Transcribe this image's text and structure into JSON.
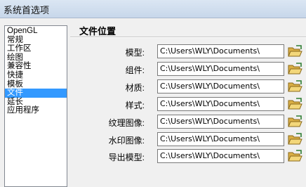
{
  "window": {
    "title": "系统首选项"
  },
  "nav": {
    "items": [
      {
        "label": "OpenGL",
        "selected": false
      },
      {
        "label": "常规",
        "selected": false
      },
      {
        "label": "工作区",
        "selected": false
      },
      {
        "label": "绘图",
        "selected": false
      },
      {
        "label": "兼容性",
        "selected": false
      },
      {
        "label": "快捷",
        "selected": false
      },
      {
        "label": "模板",
        "selected": false
      },
      {
        "label": "文件",
        "selected": true
      },
      {
        "label": "延长",
        "selected": false
      },
      {
        "label": "应用程序",
        "selected": false
      }
    ]
  },
  "section": {
    "title": "文件位置",
    "rows": [
      {
        "label": "模型:",
        "path": "C:\\Users\\WLY\\Documents\\"
      },
      {
        "label": "组件:",
        "path": "C:\\Users\\WLY\\Documents\\"
      },
      {
        "label": "材质:",
        "path": "C:\\Users\\WLY\\Documents\\"
      },
      {
        "label": "样式:",
        "path": "C:\\Users\\WLY\\Documents\\"
      },
      {
        "label": "纹理图像:",
        "path": "C:\\Users\\WLY\\Documents\\"
      },
      {
        "label": "水印图像:",
        "path": "C:\\Users\\WLY\\Documents\\"
      },
      {
        "label": "导出模型:",
        "path": "C:\\Users\\WLY\\Documents\\"
      }
    ]
  },
  "icons": {
    "browse": "folder-open-icon"
  },
  "colors": {
    "selection": "#3399ff",
    "folder": "#e8c25a"
  }
}
